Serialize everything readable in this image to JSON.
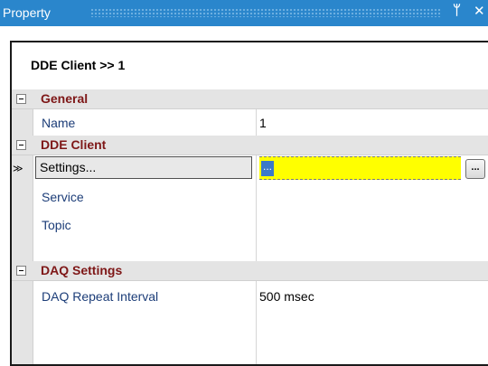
{
  "window": {
    "title": "Property",
    "pin_glyph": "ᛘ",
    "close_glyph": "✕"
  },
  "header": {
    "object_name": "DDE Client >> 1"
  },
  "categories": [
    {
      "label": "General",
      "properties": [
        {
          "name": "Name",
          "value": "1"
        }
      ]
    },
    {
      "label": "DDE Client",
      "properties": [
        {
          "name": "Settings...",
          "value": "...",
          "selected": true
        },
        {
          "name": "Service",
          "value": ""
        },
        {
          "name": "Topic",
          "value": ""
        }
      ]
    },
    {
      "label": "DAQ Settings",
      "properties": [
        {
          "name": "DAQ Repeat Interval",
          "value": "500 msec"
        }
      ]
    }
  ],
  "selection_marker": "≫",
  "editor_button_label": "...",
  "colors": {
    "title_bar": "#2a86cc",
    "category_text": "#7e1717",
    "property_text": "#1c3d78",
    "edit_highlight": "#ffff00"
  },
  "icons": {
    "collapse": "minus-box-icon",
    "pin": "pin-icon",
    "close": "close-icon"
  }
}
